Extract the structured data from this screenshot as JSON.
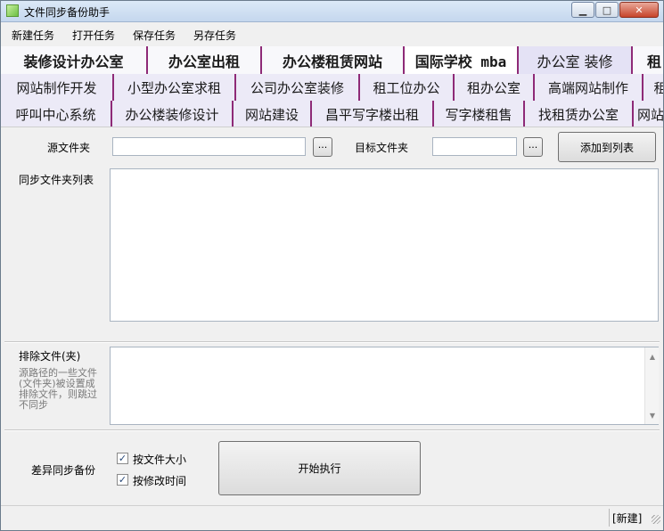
{
  "window": {
    "title": "文件同步备份助手",
    "min_glyph": "▁",
    "max_glyph": "□",
    "close_glyph": "✕"
  },
  "menu": [
    "新建任务",
    "打开任务",
    "保存任务",
    "另存任务"
  ],
  "ads": {
    "row1": [
      "装修设计办公室",
      "办公室出租",
      "办公楼租赁网站",
      "国际学校 mba",
      "办公室 装修",
      "租"
    ],
    "row2": [
      "网站制作开发",
      "小型办公室求租",
      "公司办公室装修",
      "租工位办公",
      "租办公室",
      "高端网站制作",
      "租"
    ],
    "row3": [
      "呼叫中心系统",
      "办公楼装修设计",
      "网站建设",
      "昌平写字楼出租",
      "写字楼租售",
      "找租赁办公室",
      "网站"
    ]
  },
  "form": {
    "source_label": "源文件夹",
    "source_value": "",
    "browse_label": "···",
    "target_label": "目标文件夹",
    "target_value": "",
    "add_button": "添加到列表",
    "list_label": "同步文件夹列表",
    "exclude_label": "排除文件(夹)",
    "exclude_hint": "源路径的一些文件(文件夹)被设置成排除文件，则跳过不同步",
    "diff_label": "差异同步备份",
    "check_size": "按文件大小",
    "check_time": "按修改时间",
    "check_size_checked": true,
    "check_time_checked": true,
    "start_button": "开始执行",
    "check_mark": "✓"
  },
  "status": {
    "text": "[新建]"
  },
  "icons": {
    "scroll_up": "▲",
    "scroll_down": "▼"
  }
}
